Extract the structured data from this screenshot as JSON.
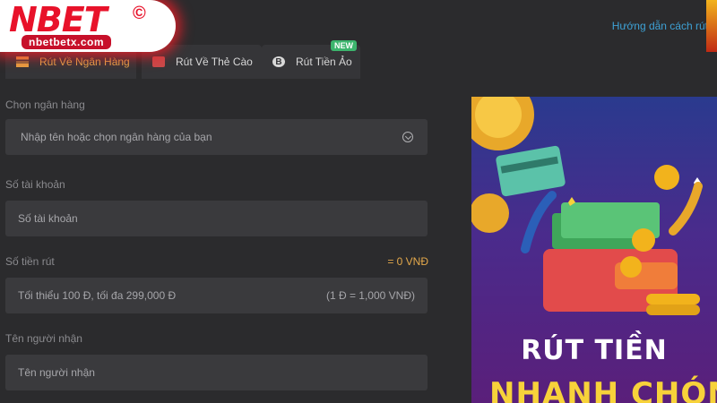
{
  "brand": {
    "logo_text": "NBET",
    "logo_mark": "©",
    "logo_url": "nbetbetx.com"
  },
  "header": {
    "help_link": "Hướng dẫn cách rút"
  },
  "tabs": [
    {
      "label": "Rút Về Ngân Hàng",
      "icon": "bank-icon",
      "active": true
    },
    {
      "label": "Rút Về Thẻ Cào",
      "icon": "card-icon",
      "active": false
    },
    {
      "label": "Rút Tiền Ảo",
      "icon": "bitcoin-icon",
      "active": false,
      "badge": "NEW",
      "coin_glyph": "B"
    }
  ],
  "form": {
    "bank": {
      "label": "Chọn ngân hàng",
      "placeholder": "Nhập tên hoặc chọn ngân hàng của bạn"
    },
    "account": {
      "label": "Số tài khoản",
      "placeholder": "Số tài khoản"
    },
    "amount": {
      "label": "Số tiền rút",
      "display": "= 0 VNĐ",
      "placeholder": "Tối thiểu 100 Đ, tối đa 299,000 Đ",
      "rate": "(1 Đ = 1,000 VNĐ)"
    },
    "recipient": {
      "label": "Tên người nhận",
      "placeholder": "Tên người nhận"
    }
  },
  "banner": {
    "line1": "RÚT TIỀN",
    "line2": "NHANH CHÓNG"
  },
  "colors": {
    "accent": "#e3a84b",
    "link": "#3ea2d6",
    "brand_red": "#e8122a",
    "badge_green": "#3cb56d"
  }
}
